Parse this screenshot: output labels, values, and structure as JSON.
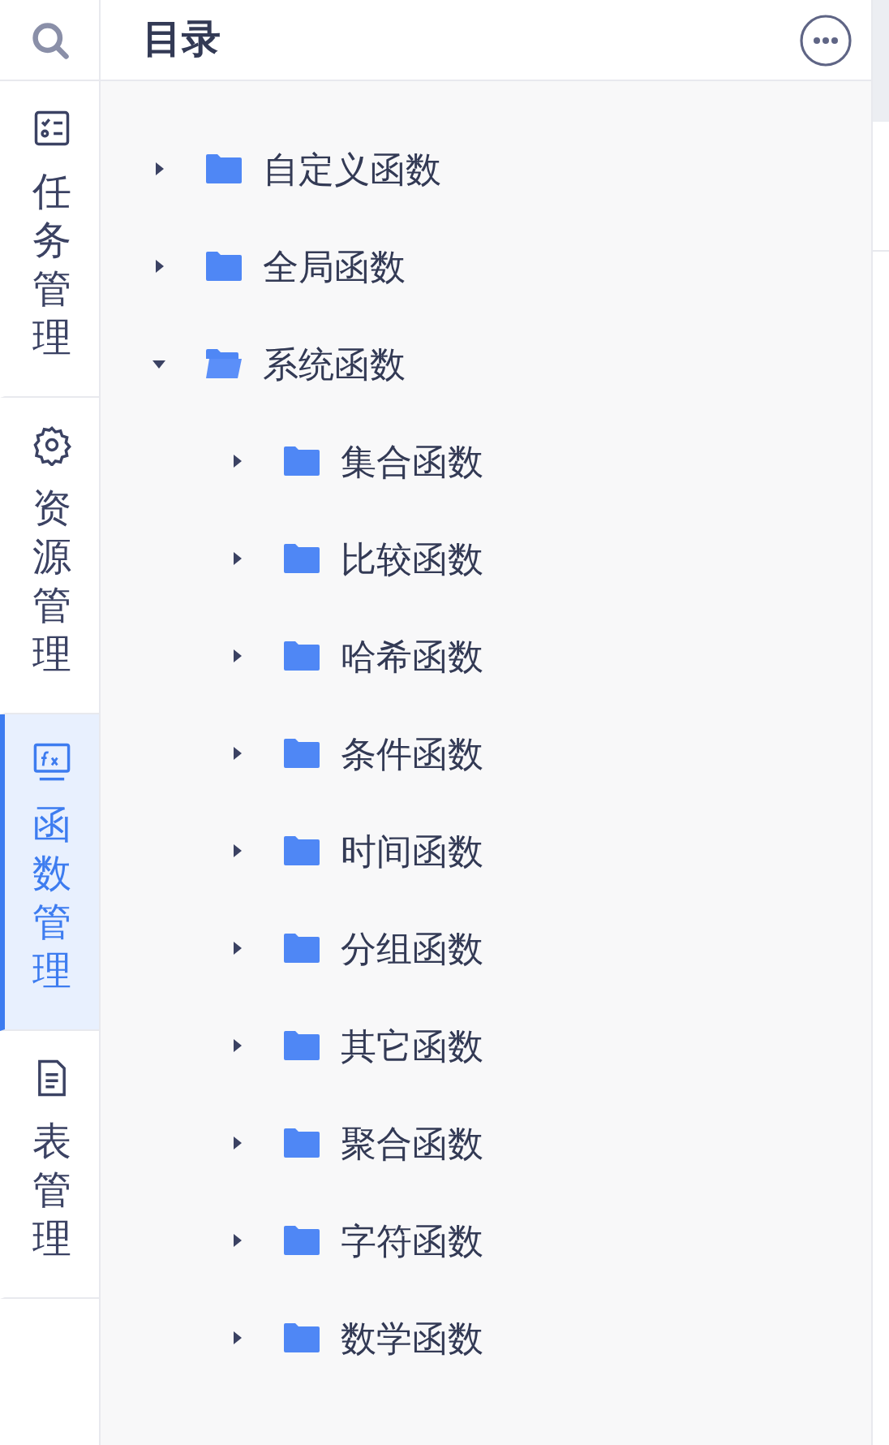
{
  "nav": [
    {
      "kind": "tasks",
      "label": "任务管理",
      "selected": false
    },
    {
      "kind": "resources",
      "label": "资源管理",
      "selected": false
    },
    {
      "kind": "functions",
      "label": "函数管理",
      "selected": true
    },
    {
      "kind": "tables",
      "label": "表管理",
      "selected": false
    }
  ],
  "panel": {
    "title": "目录"
  },
  "tree": [
    {
      "label": "自定义函数",
      "expanded": false
    },
    {
      "label": "全局函数",
      "expanded": false
    },
    {
      "label": "系统函数",
      "expanded": true,
      "children": [
        {
          "label": "集合函数",
          "expanded": false
        },
        {
          "label": "比较函数",
          "expanded": false
        },
        {
          "label": "哈希函数",
          "expanded": false
        },
        {
          "label": "条件函数",
          "expanded": false
        },
        {
          "label": "时间函数",
          "expanded": false
        },
        {
          "label": "分组函数",
          "expanded": false
        },
        {
          "label": "其它函数",
          "expanded": false
        },
        {
          "label": "聚合函数",
          "expanded": false
        },
        {
          "label": "字符函数",
          "expanded": false
        },
        {
          "label": "数学函数",
          "expanded": false
        }
      ]
    }
  ]
}
